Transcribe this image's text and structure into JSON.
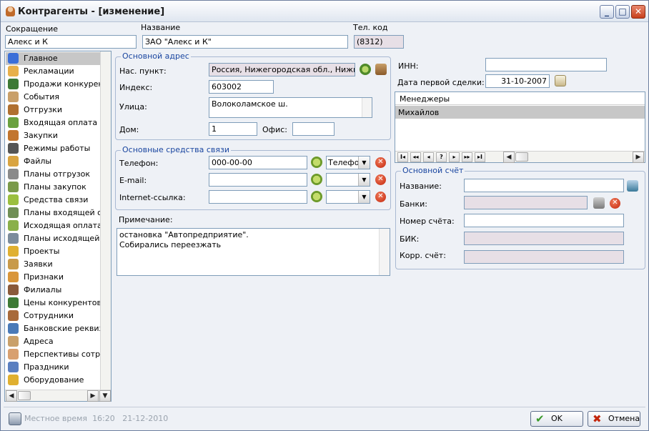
{
  "window": {
    "title": "Контрагенты - [изменение]",
    "controls": {
      "minimize": "_",
      "maximize": "□",
      "close": "✕"
    }
  },
  "header": {
    "short_name_label": "Сокращение",
    "short_name_value": "Алекс и К",
    "name_label": "Название",
    "name_value": "ЗАО \"Алекс и К\"",
    "phone_code_label": "Тел. код",
    "phone_code_value": "(8312)"
  },
  "nav": {
    "items": [
      {
        "label": "Главное",
        "color": "#3b6fd8"
      },
      {
        "label": "Рекламации",
        "color": "#e8b04a"
      },
      {
        "label": "Продажи конкурентов",
        "color": "#3d7a35"
      },
      {
        "label": "События",
        "color": "#c9a06a"
      },
      {
        "label": "Отгрузки",
        "color": "#b07030"
      },
      {
        "label": "Входящая оплата",
        "color": "#6aa13f"
      },
      {
        "label": "Закупки",
        "color": "#c2752e"
      },
      {
        "label": "Режимы работы",
        "color": "#555555"
      },
      {
        "label": "Файлы",
        "color": "#d9a441"
      },
      {
        "label": "Планы отгрузок",
        "color": "#8a8a8a"
      },
      {
        "label": "Планы закупок",
        "color": "#7a9a4a"
      },
      {
        "label": "Средства связи",
        "color": "#9bbf3f"
      },
      {
        "label": "Планы входящей оплаты",
        "color": "#6f8f55"
      },
      {
        "label": "Исходящая оплата",
        "color": "#8ab04a"
      },
      {
        "label": "Планы исходящей оплаты",
        "color": "#7c8c9c"
      },
      {
        "label": "Проекты",
        "color": "#e0b030"
      },
      {
        "label": "Заявки",
        "color": "#c89a4a"
      },
      {
        "label": "Признаки",
        "color": "#d9963a"
      },
      {
        "label": "Филиалы",
        "color": "#8a5a3a"
      },
      {
        "label": "Цены конкурентов",
        "color": "#3d7a35"
      },
      {
        "label": "Сотрудники",
        "color": "#a86a3a"
      },
      {
        "label": "Банковские реквизиты",
        "color": "#4a7ab8"
      },
      {
        "label": "Адреса",
        "color": "#c9a06a"
      },
      {
        "label": "Перспективы сотрудничества",
        "color": "#d8a070"
      },
      {
        "label": "Праздники",
        "color": "#5a7fc0"
      },
      {
        "label": "Оборудование",
        "color": "#e0b030"
      }
    ]
  },
  "address": {
    "group_title": "Основной адрес",
    "locality_label": "Нас. пункт:",
    "locality_value": "Россия, Нижегородская обл., Нижний",
    "index_label": "Индекс:",
    "index_value": "603002",
    "street_label": "Улица:",
    "street_value": "Волоколамское ш.",
    "house_label": "Дом:",
    "house_value": "1",
    "office_label": "Офис:",
    "office_value": ""
  },
  "contacts": {
    "group_title": "Основные средства связи",
    "phone_label": "Телефон:",
    "phone_value": "000-00-00",
    "phone_type": "Телефон",
    "email_label": "E-mail:",
    "email_value": "",
    "email_type": "",
    "web_label": "Internet-ссылка:",
    "web_value": "",
    "web_type": ""
  },
  "note": {
    "label": "Примечание:",
    "line1": "остановка \"Автопредприятие\".",
    "line2": "Собирались переезжать"
  },
  "right": {
    "inn_label": "ИНН:",
    "inn_value": "",
    "first_deal_label": "Дата первой сделки:",
    "first_deal_value": "31-10-2007",
    "managers_header": "Менеджеры",
    "managers_row": "Михайлов",
    "grid_nav": [
      "I◂",
      "◂◂",
      "◂",
      "?",
      "▸",
      "▸▸",
      "▸I"
    ]
  },
  "account": {
    "group_title": "Основной счёт",
    "name_label": "Название:",
    "name_value": "",
    "banks_label": "Банки:",
    "banks_value": "",
    "number_label": "Номер счёта:",
    "number_value": "",
    "bik_label": "БИК:",
    "bik_value": "",
    "corr_label": "Корр. счёт:",
    "corr_value": ""
  },
  "status": {
    "local_time_label": "Местное время",
    "time": "16:20",
    "date": "21-12-2010"
  },
  "buttons": {
    "ok": "OK",
    "cancel": "Отмена"
  }
}
